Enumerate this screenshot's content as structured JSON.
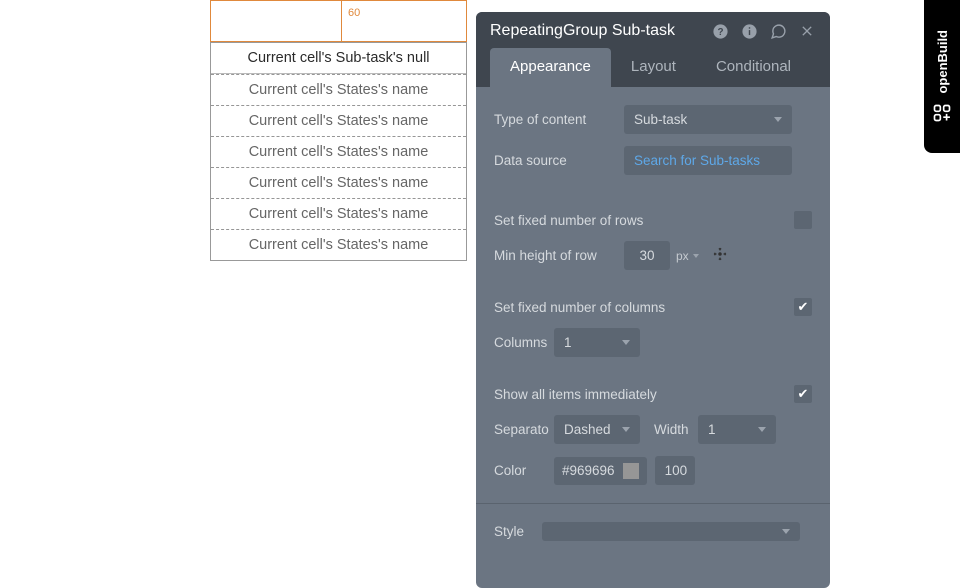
{
  "canvas": {
    "ruler_value": "60",
    "first_row": "Current cell's Sub-task's null",
    "state_row": "Current cell's States's name",
    "state_row_count": 6
  },
  "panel": {
    "title": "RepeatingGroup Sub-task",
    "tabs": {
      "appearance": "Appearance",
      "layout": "Layout",
      "conditional": "Conditional"
    },
    "props": {
      "type_label": "Type of content",
      "type_value": "Sub-task",
      "source_label": "Data source",
      "source_value": "Search for Sub-tasks",
      "fixed_rows_label": "Set fixed number of rows",
      "min_height_label": "Min height of row",
      "min_height_value": "30",
      "min_height_unit": "px",
      "fixed_cols_label": "Set fixed number of columns",
      "columns_label": "Columns",
      "columns_value": "1",
      "show_all_label": "Show all items immediately",
      "separator_label": "Separato",
      "separator_value": "Dashed",
      "width_label": "Width",
      "width_value": "1",
      "color_label": "Color",
      "color_hex": "#969696",
      "color_opacity": "100",
      "style_label": "Style"
    }
  },
  "rightbar": {
    "label": "openBuild"
  }
}
